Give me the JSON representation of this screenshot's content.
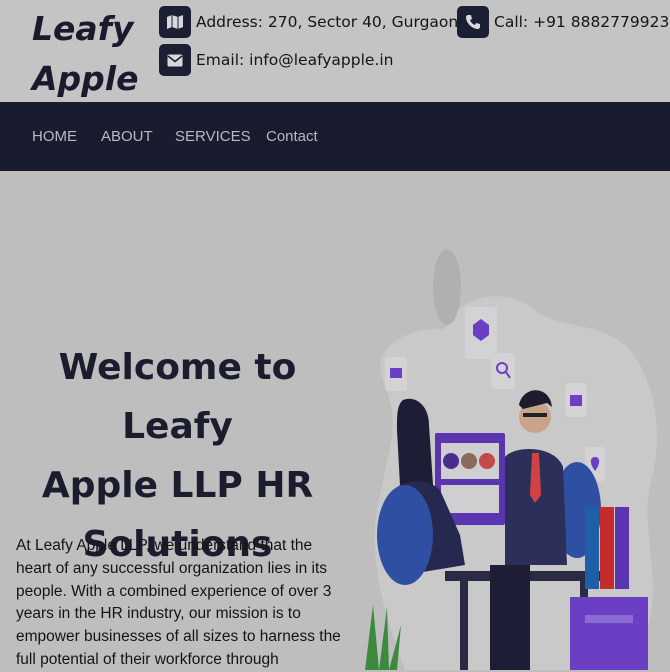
{
  "header": {
    "logo_line1": "Leafy",
    "logo_line2": "Apple",
    "address": "Address: 270, Sector 40, Gurgaon",
    "phone": "Call: +91 8882779923",
    "email": "Email: info@leafyapple.in",
    "icons": [
      "map-icon",
      "phone-icon",
      "envelope-icon"
    ]
  },
  "nav": {
    "items": [
      {
        "label": "HOME"
      },
      {
        "label": "ABOUT"
      },
      {
        "label": "SERVICES"
      },
      {
        "label": "Contact"
      }
    ]
  },
  "hero": {
    "title_lines": [
      "Welcome to Leafy",
      "Apple LLP HR",
      "Solutions"
    ],
    "paragraph_lines": [
      "At Leafy Apple LLP, we understand that the",
      "heart of any successful organization lies in its",
      "people. With a combined experience of over 3",
      "years in the HR industry, our mission is to",
      "empower businesses of all sizes to harness the",
      "full potential of their workforce through"
    ]
  },
  "colors": {
    "overlay_background": "#bebebe",
    "nav_background": "#191b2f",
    "icon_tile": "#1c1e33",
    "accent_purple": "#6a3fc4"
  }
}
